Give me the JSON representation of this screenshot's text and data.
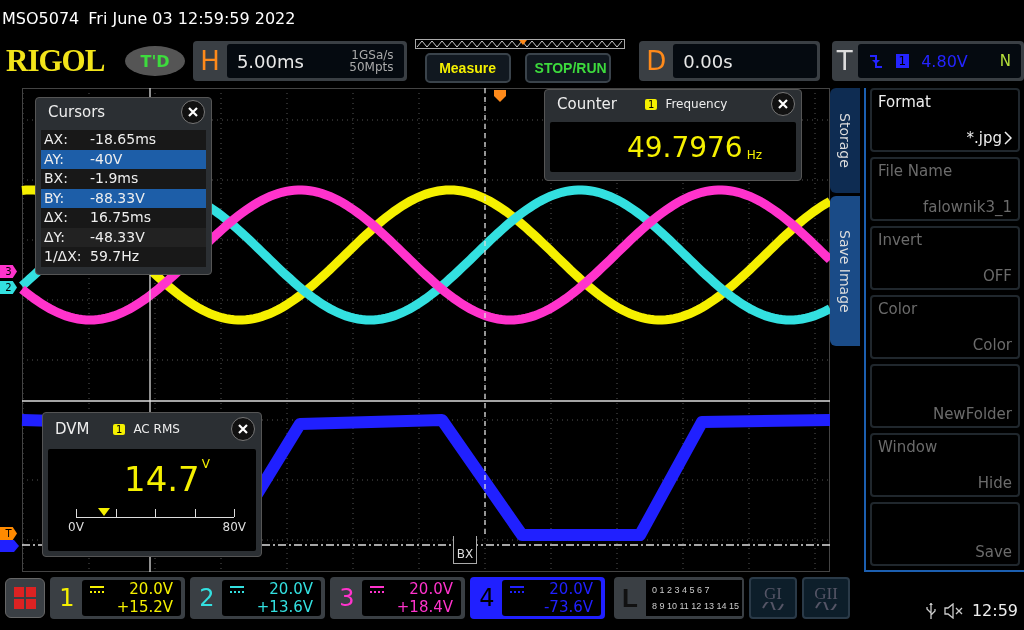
{
  "status_line": {
    "model": "MSO5074",
    "datetime": "Fri June 03 12:59:59 2022"
  },
  "header": {
    "logo": "RIGOL",
    "mode_badge": "T'D",
    "horizontal": {
      "label": "H",
      "timebase": "5.00ms",
      "sample_rate": "1GSa/s",
      "memory_depth": "50Mpts"
    },
    "buttons": [
      {
        "label": "Measure",
        "kind": "measure"
      },
      {
        "label": "STOP/RUN",
        "kind": "run"
      }
    ],
    "delay": {
      "label": "D",
      "value": "0.00s"
    },
    "trigger": {
      "label": "T",
      "source": "1",
      "level": "4.80V",
      "sweep": "N"
    }
  },
  "screen": {
    "left_markers": [
      {
        "label": "3",
        "color": "#ff33cc"
      },
      {
        "label": "2",
        "color": "#33e0e0"
      },
      {
        "label": "T",
        "color": "#ff8a00"
      }
    ],
    "cursor_label": "BX",
    "cursors": {
      "title": "Cursors",
      "rows": [
        {
          "label": "AX:",
          "value": "-18.65ms",
          "selected": false
        },
        {
          "label": "AY:",
          "value": "-40V",
          "selected": true
        },
        {
          "label": "BX:",
          "value": "-1.9ms",
          "selected": false
        },
        {
          "label": "BY:",
          "value": "-88.33V",
          "selected": true
        },
        {
          "label": "ΔX:",
          "value": "16.75ms",
          "selected": false
        },
        {
          "label": "ΔY:",
          "value": "-48.33V",
          "selected": false
        },
        {
          "label": "1/ΔX:",
          "value": "59.7Hz",
          "selected": false
        }
      ]
    },
    "counter": {
      "title": "Counter",
      "source": "1",
      "measurement": "Frequency",
      "value": "49.7976",
      "unit": "Hz"
    },
    "dvm": {
      "title": "DVM",
      "source": "1",
      "mode": "AC RMS",
      "value": "14.7",
      "unit": "V",
      "level": 0.18,
      "scale_min": "0V",
      "scale_max": "80V"
    }
  },
  "side_tabs": [
    {
      "label": "Storage",
      "selected": false
    },
    {
      "label": "Save Image",
      "selected": true
    }
  ],
  "menu": [
    {
      "label": "Format",
      "value": "*.jpg",
      "disabled": false,
      "submenu": true
    },
    {
      "label": "File Name",
      "value": "falownik3_1",
      "disabled": true,
      "submenu": false
    },
    {
      "label": "Invert",
      "value": "OFF",
      "disabled": true,
      "submenu": false
    },
    {
      "label": "Color",
      "value": "Color",
      "disabled": true,
      "submenu": false
    },
    {
      "value": "NewFolder",
      "disabled": true,
      "submenu": false
    },
    {
      "label": "Window",
      "value": "Hide",
      "disabled": true,
      "submenu": false
    },
    {
      "value": "Save",
      "disabled": true,
      "submenu": false
    }
  ],
  "channels": [
    {
      "number": "1",
      "scale": "20.0V",
      "offset": "+15.2V",
      "color": "#f5f000",
      "selected": false
    },
    {
      "number": "2",
      "scale": "20.0V",
      "offset": "+13.6V",
      "color": "#33e0e0",
      "selected": false
    },
    {
      "number": "3",
      "scale": "20.0V",
      "offset": "+18.4V",
      "color": "#ff33cc",
      "selected": false
    },
    {
      "number": "4",
      "scale": "20.0V",
      "offset": "-73.6V",
      "color": "#2020ff",
      "selected": true
    }
  ],
  "logic": {
    "label": "L",
    "bits_row_1": "0 1 2 3  4 5 6 7",
    "bits_row_2": "8 9 10 11 12 13 14 15"
  },
  "generators": [
    {
      "label": "GI"
    },
    {
      "label": "GII"
    }
  ],
  "clock": "12:59"
}
